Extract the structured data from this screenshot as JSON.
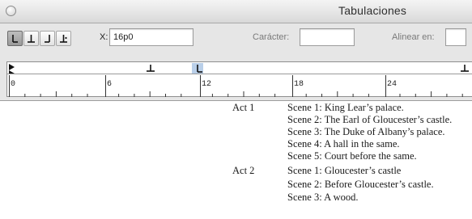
{
  "window": {
    "title": "Tabulaciones"
  },
  "tab_buttons": [
    {
      "name": "left-justified-tab-button",
      "icon": "tab-left-icon",
      "selected": true
    },
    {
      "name": "center-justified-tab-button",
      "icon": "tab-center-icon",
      "selected": false
    },
    {
      "name": "right-justified-tab-button",
      "icon": "tab-right-icon",
      "selected": false
    },
    {
      "name": "align-to-decimal-tab-button",
      "icon": "tab-decimal-icon",
      "selected": false
    }
  ],
  "fields": {
    "x_label": "X:",
    "x_value": "16p0",
    "char_label": "Carácter:",
    "char_value": "",
    "align_label": "Alinear en:",
    "align_value": ""
  },
  "ruler": {
    "labels": [
      "0",
      "6",
      "12",
      "18",
      "24"
    ]
  },
  "document": {
    "lines": [
      {
        "act": "Act 1",
        "scene": "Scene 1: King Lear’s palace."
      },
      {
        "act": "",
        "scene": "Scene 2: The Earl of Gloucester’s castle."
      },
      {
        "act": "",
        "scene": "Scene 3: The Duke of Albany’s palace."
      },
      {
        "act": "",
        "scene": "Scene 4: A hall in the same."
      },
      {
        "act": "",
        "scene": "Scene 5: Court before the same."
      },
      {
        "act": "Act 2",
        "scene": "Scene 1: Gloucester’s castle"
      },
      {
        "act": "",
        "scene": "Scene 2: Before Gloucester’s castle."
      },
      {
        "act": "",
        "scene": "Scene 3: A wood."
      }
    ]
  }
}
